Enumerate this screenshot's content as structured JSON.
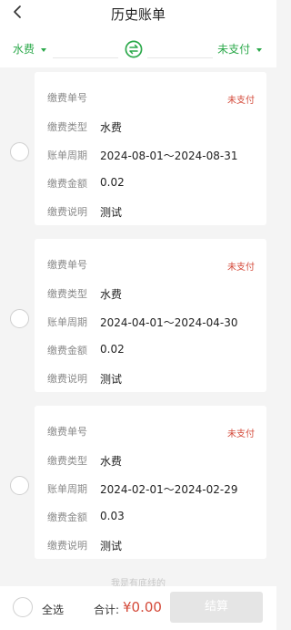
{
  "header": {
    "title": "历史账单"
  },
  "filter": {
    "left_label": "水费",
    "right_label": "未支付"
  },
  "bills": [
    {
      "status": "未支付",
      "fields": [
        {
          "label": "缴费单号",
          "value": ""
        },
        {
          "label": "缴费类型",
          "value": "水费"
        },
        {
          "label": "账单周期",
          "value": "2024-08-01～2024-08-31"
        },
        {
          "label": "缴费金额",
          "value": "0.02"
        },
        {
          "label": "缴费说明",
          "value": "测试"
        }
      ]
    },
    {
      "status": "未支付",
      "fields": [
        {
          "label": "缴费单号",
          "value": ""
        },
        {
          "label": "缴费类型",
          "value": "水费"
        },
        {
          "label": "账单周期",
          "value": "2024-04-01～2024-04-30"
        },
        {
          "label": "缴费金额",
          "value": "0.02"
        },
        {
          "label": "缴费说明",
          "value": "测试"
        }
      ]
    },
    {
      "status": "未支付",
      "fields": [
        {
          "label": "缴费单号",
          "value": ""
        },
        {
          "label": "缴费类型",
          "value": "水费"
        },
        {
          "label": "账单周期",
          "value": "2024-02-01～2024-02-29"
        },
        {
          "label": "缴费金额",
          "value": "0.03"
        },
        {
          "label": "缴费说明",
          "value": "测试"
        }
      ]
    }
  ],
  "footer": {
    "hint": "我是有底线的",
    "select_all": "全选",
    "total_label": "合计:",
    "total_value": "¥0.00",
    "settle_button": "结算"
  },
  "colors": {
    "accent": "#2ca94b",
    "danger": "#d44a3a",
    "muted": "#8a8a8a"
  }
}
